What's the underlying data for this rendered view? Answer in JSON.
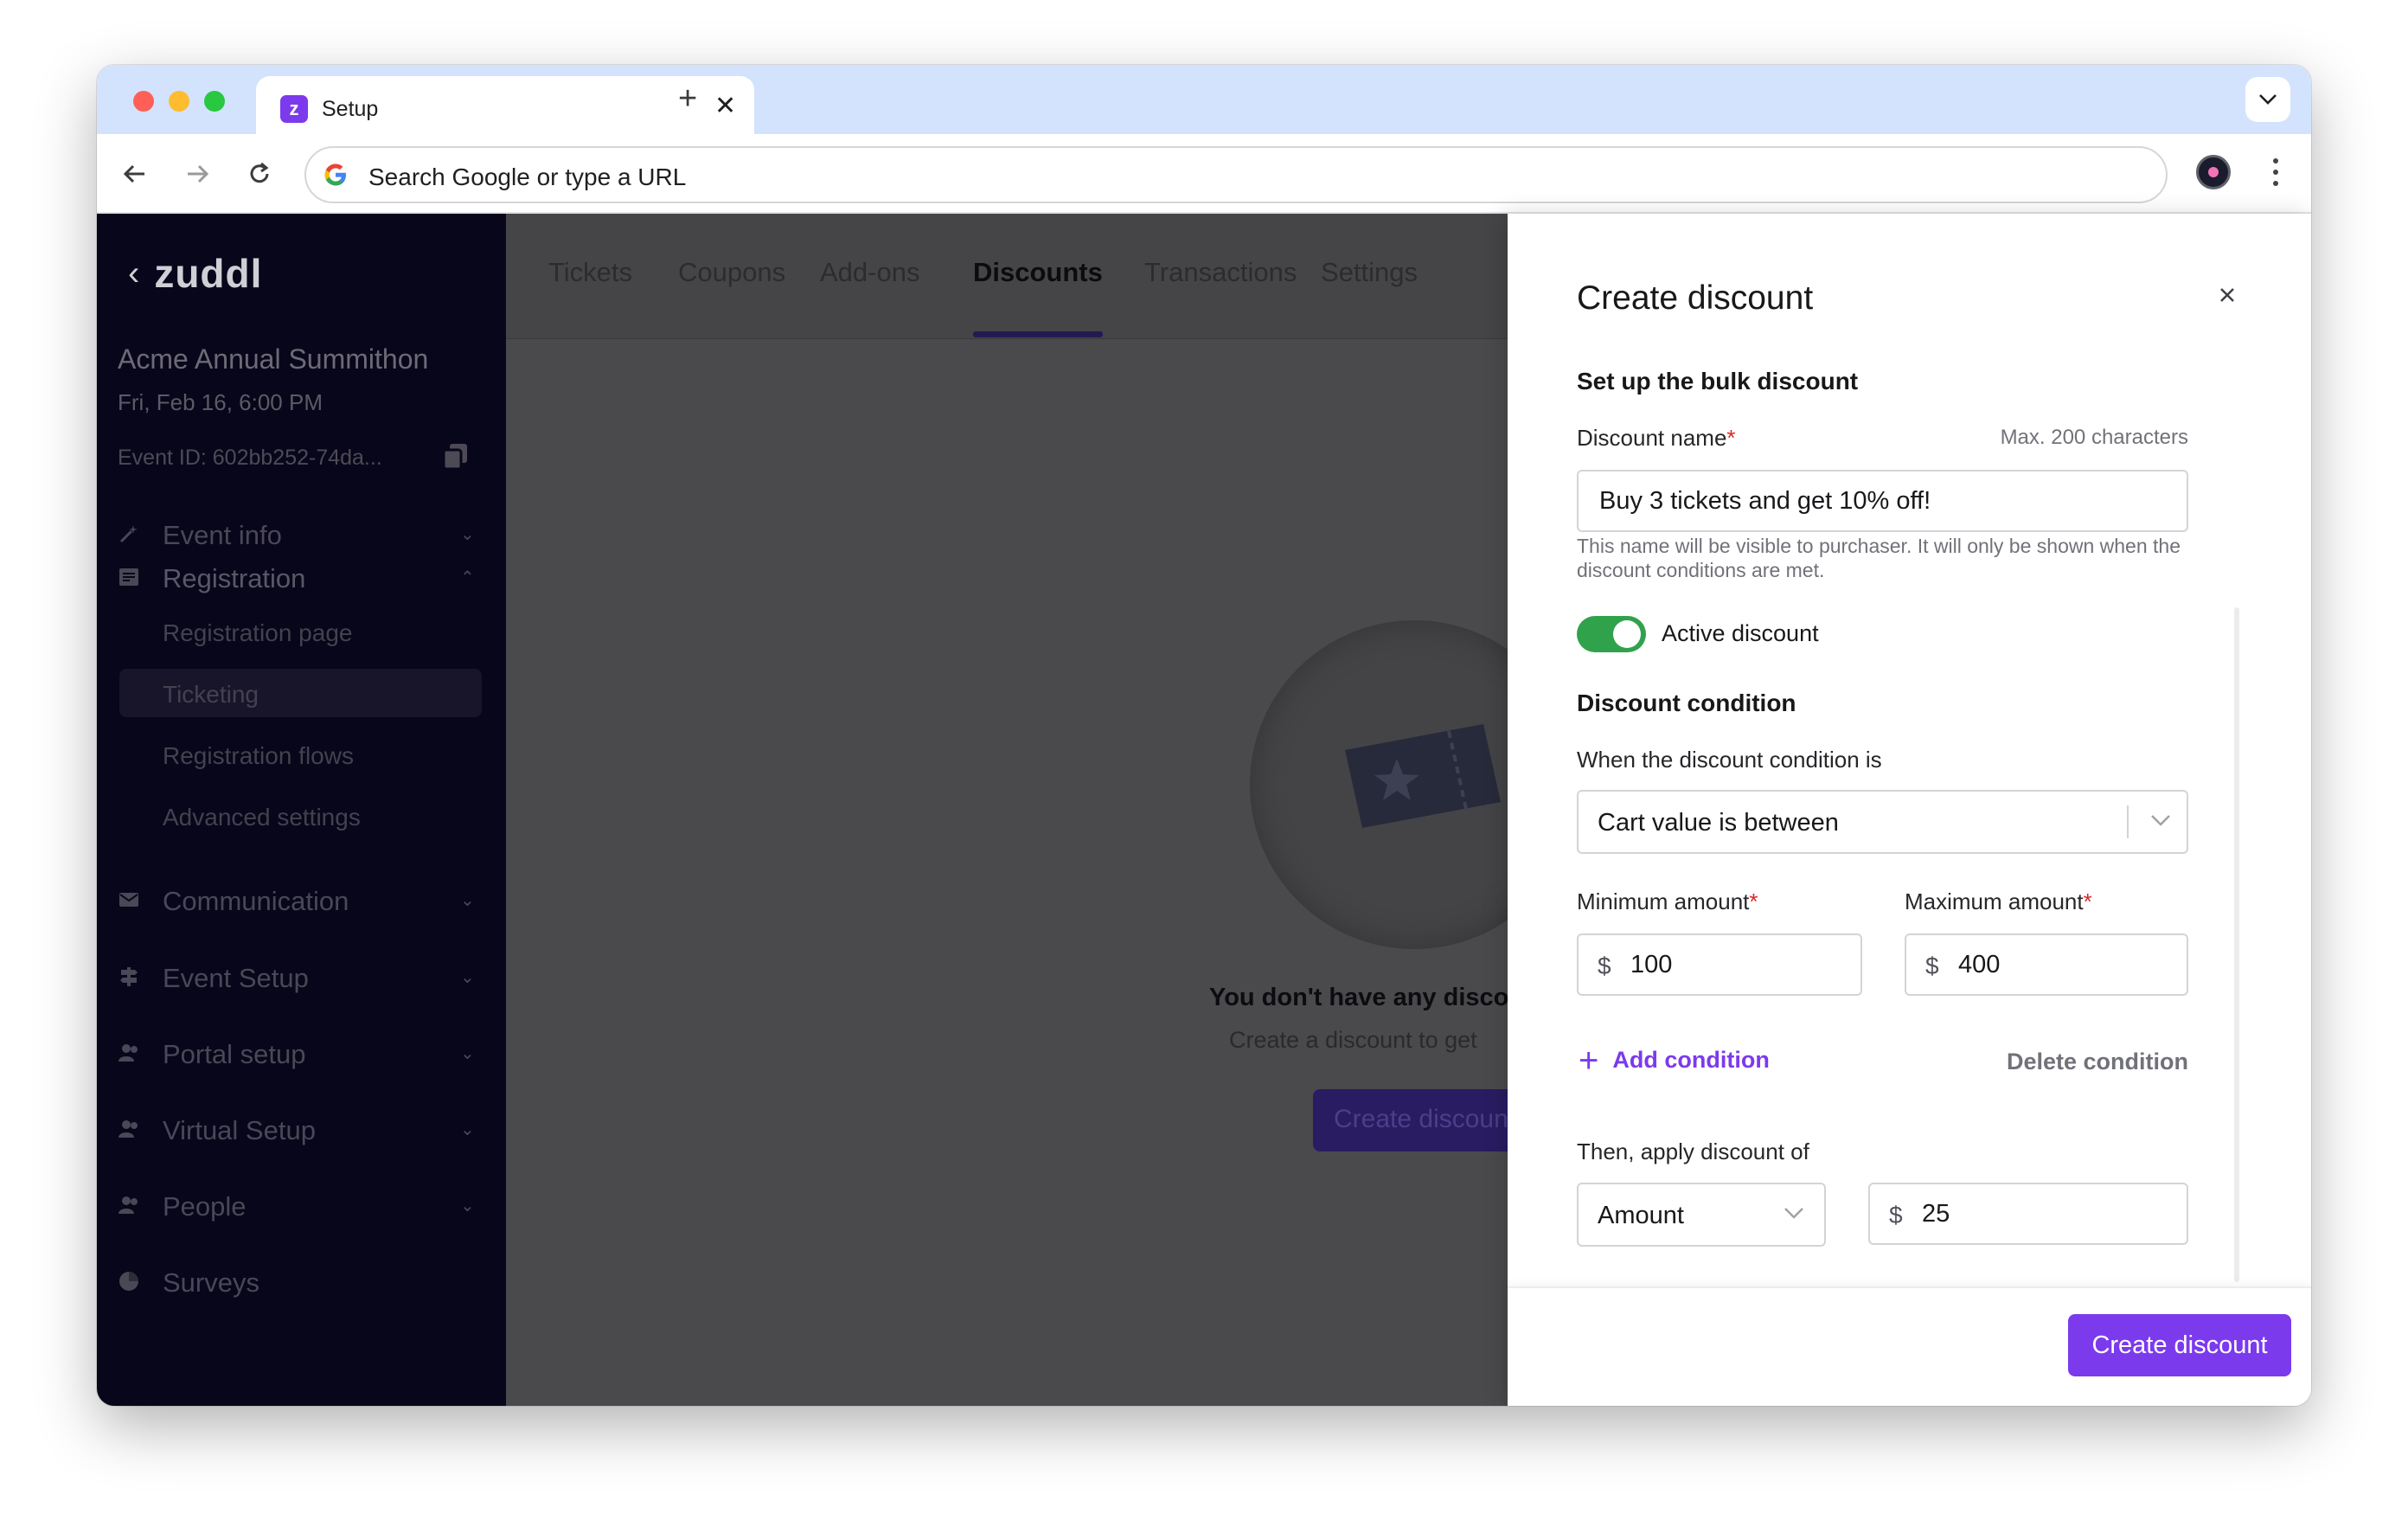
{
  "browser": {
    "tab_title": "Setup",
    "tab_close": "✕",
    "new_tab": "+",
    "omnibox_placeholder": "Search Google or type a URL"
  },
  "sidebar": {
    "brand": "zuddl",
    "event_title": "Acme Annual Summithon",
    "event_date": "Fri, Feb 16, 6:00 PM",
    "event_id": "Event ID: 602bb252-74da...",
    "items": [
      {
        "label": "Event info",
        "icon": "magic-wand-icon"
      },
      {
        "label": "Registration",
        "icon": "form-icon"
      },
      {
        "label": "Communication",
        "icon": "mail-icon"
      },
      {
        "label": "Event Setup",
        "icon": "signpost-icon"
      },
      {
        "label": "Portal setup",
        "icon": "people-icon"
      },
      {
        "label": "Virtual Setup",
        "icon": "people-icon"
      },
      {
        "label": "People",
        "icon": "people-icon"
      },
      {
        "label": "Surveys",
        "icon": "pie-chart-icon"
      }
    ],
    "registration_sub": [
      "Registration page",
      "Ticketing",
      "Registration flows",
      "Advanced settings"
    ]
  },
  "main": {
    "tabs": [
      "Tickets",
      "Coupons",
      "Add-ons",
      "Discounts",
      "Transactions",
      "Settings"
    ],
    "active_tab": "Discounts",
    "empty_title": "You don't have any disco",
    "empty_sub": "Create a discount to get",
    "empty_button": "Create discount"
  },
  "drawer": {
    "title": "Create discount",
    "section_setup": "Set up the bulk discount",
    "name_label": "Discount name",
    "required_mark": "*",
    "max_chars": "Max. 200 characters",
    "name_value": "Buy 3 tickets and get 10% off!",
    "name_hint": "This name will be visible to purchaser. It will only be shown when the discount conditions are met.",
    "active_label": "Active discount",
    "active": true,
    "section_condition": "Discount condition",
    "condition_label": "When the discount condition is",
    "condition_value": "Cart value is between",
    "min_label": "Minimum amount",
    "max_label": "Maximum amount",
    "currency": "$",
    "min_value": "100",
    "max_value": "400",
    "add_condition": "Add condition",
    "delete_condition": "Delete condition",
    "apply_label": "Then, apply discount of",
    "apply_type": "Amount",
    "apply_value": "25",
    "create_button": "Create discount"
  },
  "colors": {
    "accent": "#7c3aed",
    "toggle_on": "#31a24c",
    "sidebar_bg": "#08061a",
    "required": "#dc2626"
  }
}
